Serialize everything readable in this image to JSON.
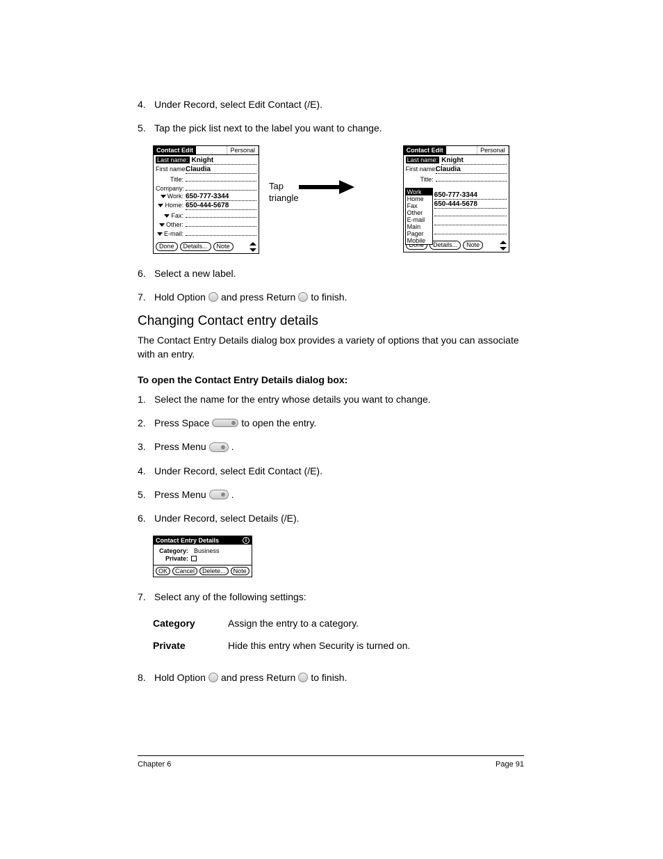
{
  "steps_a": [
    {
      "n": "4.",
      "t": "Under Record, select Edit Contact (/E)."
    },
    {
      "n": "5.",
      "t": "Tap the pick list next to the label you want to change."
    }
  ],
  "steps_b": [
    {
      "n": "6.",
      "t": "Select a new label."
    }
  ],
  "step7a_option": "Hold Option",
  "step7a_return": "and press Return",
  "step7a_finish": "to finish.",
  "section_title": "Changing Contact entry details",
  "section_para": "The Contact Entry Details dialog box provides a variety of options that you can associate with an entry.",
  "proc_title": "To open the Contact Entry Details dialog box:",
  "proc": [
    {
      "n": "1.",
      "t": "Select the name for the entry whose details you want to change."
    }
  ],
  "proc2_press": "Press Space",
  "proc2_after": "to open the entry.",
  "proc3_press": "Press Menu",
  "proc4": "Under Record, select Edit Contact (/E).",
  "proc5_press": "Press Menu",
  "proc6": "Under Record, select Details (/E).",
  "proc7": "Select any of the following settings:",
  "settings": [
    {
      "k": "Category",
      "v": "Assign the entry to a category."
    },
    {
      "k": "Private",
      "v": "Hide this entry when Security is turned on."
    }
  ],
  "proc8_option": "Hold Option",
  "proc8_return": "and press Return",
  "proc8_finish": "to finish.",
  "footer_left": "Chapter 6",
  "footer_right": "Page 91",
  "tap_label_1": "Tap",
  "tap_label_2": "triangle",
  "palm": {
    "title": "Contact Edit",
    "cat": "Personal",
    "last_lbl": "Last name:",
    "last": "Knight",
    "first_lbl": "First name:",
    "first": "Claudia",
    "title_lbl": "Title:",
    "company_lbl": "Company:",
    "work_lbl": "Work:",
    "work": "650-777-3344",
    "home_lbl": "Home:",
    "home": "650-444-5678",
    "fax_lbl": "Fax:",
    "other_lbl": "Other:",
    "email_lbl": "E-mail:",
    "done": "Done",
    "details": "Details...",
    "note": "Note",
    "popup": [
      "Work",
      "Home",
      "Fax",
      "Other",
      "E-mail",
      "Main",
      "Pager",
      "Mobile"
    ]
  },
  "det": {
    "title": "Contact Entry Details",
    "cat_lbl": "Category:",
    "cat": "Business",
    "priv_lbl": "Private:",
    "ok": "OK",
    "cancel": "Cancel",
    "delete": "Delete...",
    "note": "Note"
  }
}
